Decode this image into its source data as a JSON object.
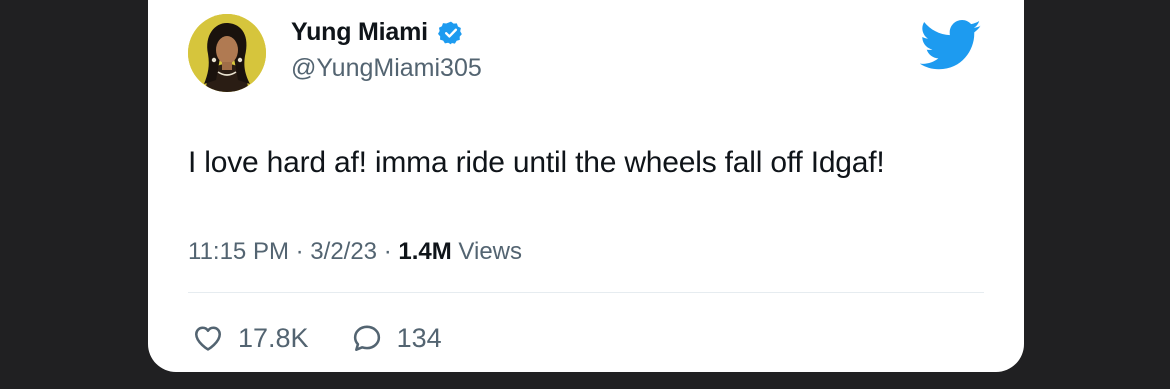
{
  "author": {
    "display_name": "Yung Miami",
    "handle": "@YungMiami305",
    "verified": true,
    "avatar_icon": "profile-photo"
  },
  "brand": {
    "icon": "twitter-bird-icon",
    "color": "#1d9bf0"
  },
  "tweet": {
    "text": "I love hard af! imma ride until the wheels fall off Idgaf!",
    "time": "11:15 PM",
    "date": "3/2/23",
    "views_count": "1.4M",
    "views_label": "Views"
  },
  "actions": {
    "likes": {
      "icon": "heart-icon",
      "count": "17.8K"
    },
    "replies": {
      "icon": "reply-icon",
      "count": "134"
    }
  },
  "colors": {
    "background": "#202022",
    "card": "#ffffff",
    "text_primary": "#0f1419",
    "text_secondary": "#536471",
    "verified": "#1d9bf0"
  }
}
